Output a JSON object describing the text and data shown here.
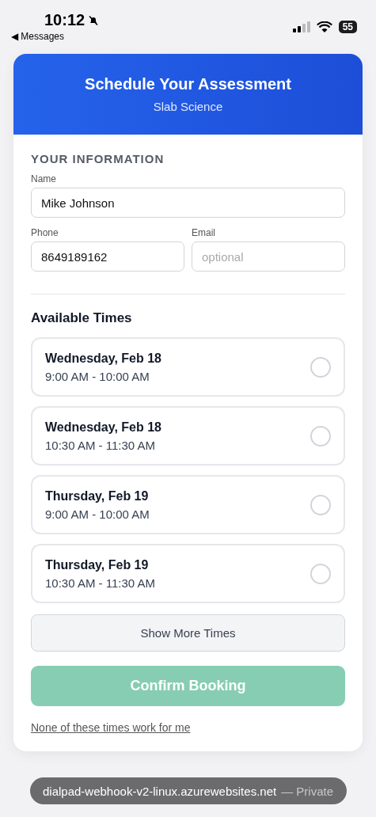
{
  "status_bar": {
    "time": "10:12",
    "back": "◀ Messages",
    "battery": "55",
    "silent": true
  },
  "header": {
    "title": "Schedule Your Assessment",
    "subtitle": "Slab Science"
  },
  "section_title": "YOUR INFORMATION",
  "field_rows": [
    [
      {
        "label": "Name",
        "value": "Mike Johnson"
      }
    ],
    [
      {
        "label": "Phone",
        "value": "8649189162"
      },
      {
        "label": "Email",
        "placeholder": "optional"
      }
    ]
  ],
  "times_title": "Available Times",
  "slots": [
    {
      "day": "Wednesday, Feb 18",
      "time": "9:00 AM - 10:00 AM",
      "selected": false
    },
    {
      "day": "Wednesday, Feb 18",
      "time": "10:30 AM - 11:30 AM",
      "selected": false
    },
    {
      "day": "Thursday, Feb 19",
      "time": "9:00 AM - 10:00 AM",
      "selected": false
    },
    {
      "day": "Thursday, Feb 19",
      "time": "10:30 AM - 11:30 AM",
      "selected": false
    }
  ],
  "show_more": "Show More Times",
  "confirm": {
    "label": "Confirm Booking",
    "disabled": true
  },
  "none_link": "None of these times work for me",
  "url_bar": {
    "url": "dialpad-webhook-v2-linux.azurewebsites.net",
    "suffix": "— Private"
  }
}
